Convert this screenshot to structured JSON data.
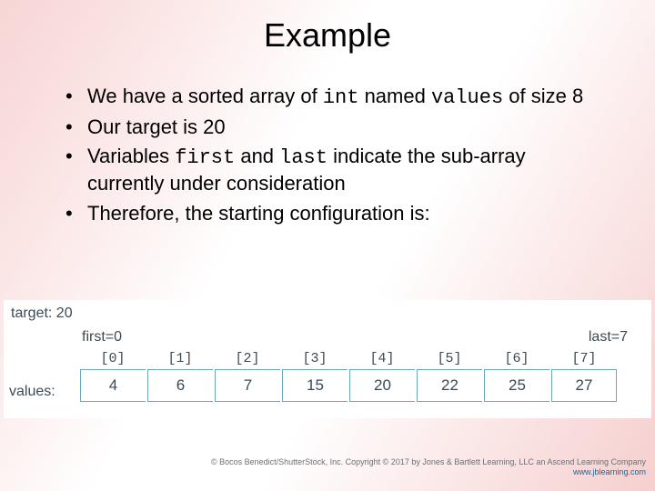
{
  "title": "Example",
  "bullets": {
    "b1_pre": "We have a sorted array of ",
    "b1_code1": "int",
    "b1_mid": " named ",
    "b1_code2": "values",
    "b1_post": " of size 8",
    "b2": "Our target is 20",
    "b3_pre": "Variables ",
    "b3_code1": "first",
    "b3_mid": " and ",
    "b3_code2": "last",
    "b3_post": " indicate the sub-array currently under consideration",
    "b4": "Therefore, the starting configuration is:"
  },
  "diagram": {
    "target_label": "target: 20",
    "first_label": "first=0",
    "last_label": "last=7",
    "values_label": "values:",
    "indices": [
      "[0]",
      "[1]",
      "[2]",
      "[3]",
      "[4]",
      "[5]",
      "[6]",
      "[7]"
    ],
    "values": [
      "4",
      "6",
      "7",
      "15",
      "20",
      "22",
      "25",
      "27"
    ]
  },
  "copyright": {
    "line1": "© Bocos Benedict/ShutterStock, Inc. Copyright © 2017 by Jones & Bartlett Learning, LLC an Ascend Learning Company",
    "line2": "www.jblearning.com"
  },
  "chart_data": {
    "type": "table",
    "title": "Binary search starting configuration",
    "target": 20,
    "first": 0,
    "last": 7,
    "categories": [
      0,
      1,
      2,
      3,
      4,
      5,
      6,
      7
    ],
    "values": [
      4,
      6,
      7,
      15,
      20,
      22,
      25,
      27
    ]
  }
}
